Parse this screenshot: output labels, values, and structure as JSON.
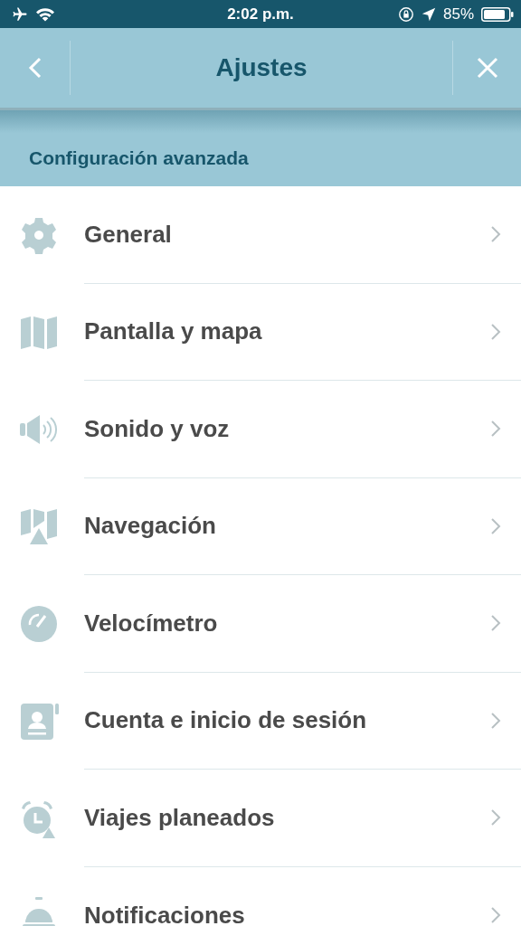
{
  "status_bar": {
    "time": "2:02 p.m.",
    "battery": "85%"
  },
  "header": {
    "title": "Ajustes"
  },
  "section": {
    "title": "Configuración avanzada"
  },
  "items": [
    {
      "kind": "gear",
      "label": "General"
    },
    {
      "kind": "map",
      "label": "Pantalla y mapa"
    },
    {
      "kind": "speaker",
      "label": "Sonido y voz"
    },
    {
      "kind": "navigation",
      "label": "Navegación"
    },
    {
      "kind": "speedometer",
      "label": "Velocímetro"
    },
    {
      "kind": "account",
      "label": "Cuenta e inicio de sesión"
    },
    {
      "kind": "alarm",
      "label": "Viajes planeados"
    },
    {
      "kind": "bell",
      "label": "Notificaciones"
    }
  ]
}
